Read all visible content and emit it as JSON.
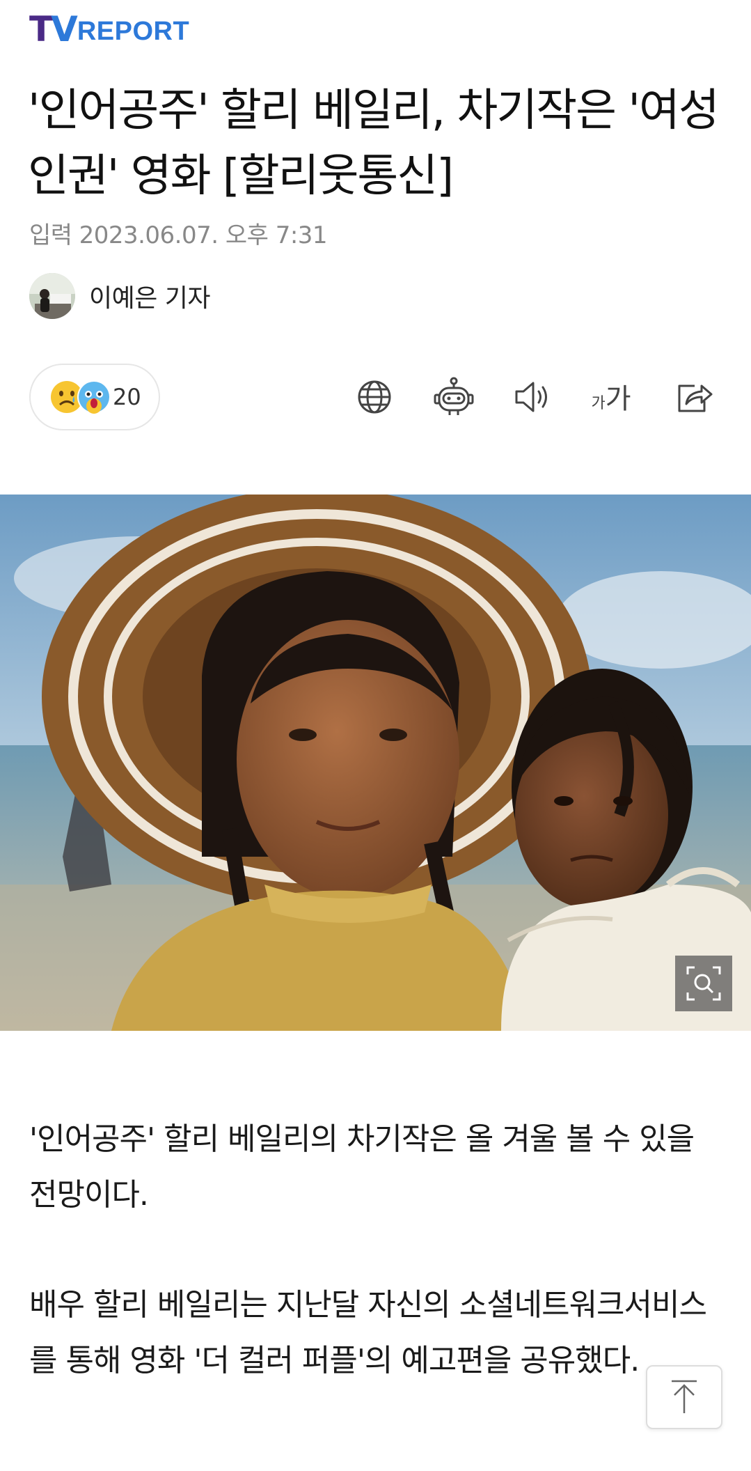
{
  "brand": {
    "logo_tv_t": "T",
    "logo_tv_v": "V",
    "logo_report": "REPORT"
  },
  "article": {
    "title": "'인어공주' 할리 베일리, 차기작은 '여성 인권' 영화 [할리웃통신]",
    "date_label": "입력",
    "date_value": "2023.06.07. 오후 7:31",
    "author": "이예은 기자"
  },
  "reactions": {
    "count": "20",
    "emojis": [
      "sad-face",
      "surprised-face"
    ]
  },
  "toolbar": {
    "icons": [
      "globe-icon",
      "robot-summary-icon",
      "speaker-icon",
      "font-size-icon",
      "share-icon"
    ],
    "font_small": "가",
    "font_big": "가"
  },
  "body": {
    "p1": "'인어공주' 할리 베일리의 차기작은 올 겨울 볼 수 있을 전망이다.",
    "p2": "배우 할리 베일리는 지난달 자신의 소셜네트워크서비스를 통해 영화 '더 컬러 퍼플'의 예고편을 공유했다."
  },
  "colors": {
    "brand_purple": "#4a2a86",
    "brand_blue": "#2d79d9",
    "muted_text": "#888888"
  }
}
